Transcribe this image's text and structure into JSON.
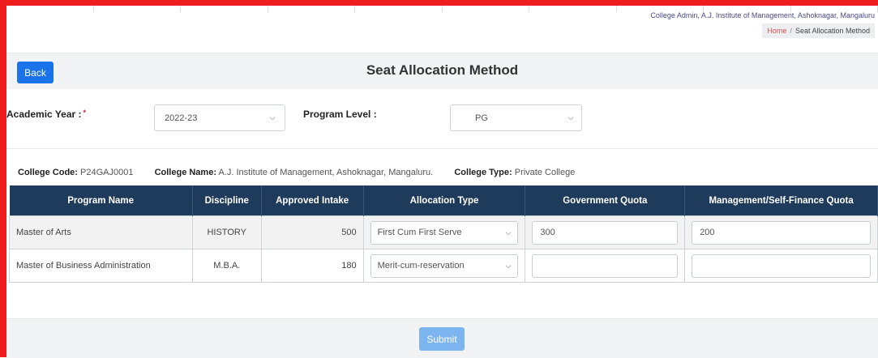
{
  "header": {
    "admin_line": "College Admin, A.J. Institute of Management, Ashoknagar, Mangaluru",
    "breadcrumb": {
      "home": "Home",
      "separator": "/",
      "current": "Seat Allocation Method"
    }
  },
  "page": {
    "title": "Seat Allocation Method",
    "back_label": "Back"
  },
  "filters": {
    "academic_year": {
      "label": "Academic Year :",
      "required_mark": "*",
      "value": "2022-23"
    },
    "program_level": {
      "label": "Program Level :",
      "value": "PG"
    }
  },
  "college": {
    "code_label": "College Code:",
    "code": "P24GAJ0001",
    "name_label": "College Name:",
    "name": "A.J. Institute of Management, Ashoknagar, Mangaluru.",
    "type_label": "College Type:",
    "type": "Private College"
  },
  "table": {
    "columns": [
      "Program Name",
      "Discipline",
      "Approved Intake",
      "Allocation Type",
      "Government Quota",
      "Management/Self-Finance Quota"
    ],
    "rows": [
      {
        "program": "Master of Arts",
        "discipline": "HISTORY",
        "intake": "500",
        "allocation": "First Cum First Serve",
        "gov_quota": "300",
        "mgmt_quota": "200"
      },
      {
        "program": "Master of Business Administration",
        "discipline": "M.B.A.",
        "intake": "180",
        "allocation": "Merit-cum-reservation",
        "gov_quota": "",
        "mgmt_quota": ""
      }
    ]
  },
  "actions": {
    "submit_label": "Submit"
  },
  "colors": {
    "frame": "#ee1c1c",
    "primary": "#1a73e8",
    "table_header": "#1f3b5b",
    "submit_disabled": "#7db5f0"
  }
}
